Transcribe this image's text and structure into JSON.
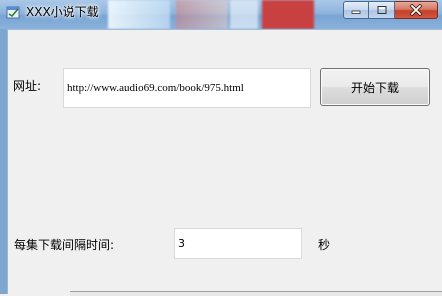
{
  "window": {
    "title": "XXX小说下载",
    "buttons": {
      "minimize_icon": "minimize-icon",
      "maximize_icon": "maximize-icon",
      "close_icon": "close-icon"
    }
  },
  "form": {
    "url_label": "网址:",
    "url_value": "http://www.audio69.com/book/975.html",
    "start_button_label": "开始下载",
    "interval_label": "每集下载间隔时间:",
    "interval_value": "3",
    "interval_unit": "秒"
  },
  "colors": {
    "close_button": "#c4412a",
    "titlebar": "#8fb4dc",
    "client_bg": "#f0f0f0"
  }
}
